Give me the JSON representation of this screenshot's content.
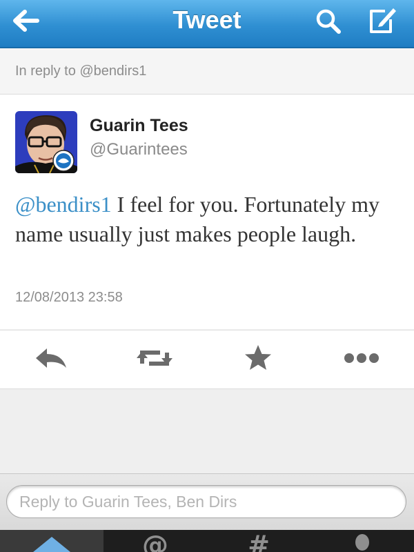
{
  "header": {
    "title": "Tweet",
    "back_icon": "back-arrow-icon",
    "search_icon": "search-icon",
    "compose_icon": "compose-icon"
  },
  "context": {
    "in_reply_to": "In reply to @bendirs1"
  },
  "tweet": {
    "author_name": "Guarin Tees",
    "author_handle": "@Guarintees",
    "mention": "@bendirs1",
    "text": " I feel for you. Fortunately my name usually just makes people laugh.",
    "timestamp": "12/08/2013 23:58"
  },
  "actions": [
    "reply-icon",
    "retweet-icon",
    "favorite-star-icon",
    "more-dots-icon"
  ],
  "reply_box": {
    "placeholder": "Reply to Guarin Tees, Ben Dirs"
  },
  "tabs": [
    {
      "name": "home",
      "icon": "home-icon",
      "glyph": ""
    },
    {
      "name": "connect",
      "icon": "at-icon",
      "glyph": "@"
    },
    {
      "name": "discover",
      "icon": "hashtag-icon",
      "glyph": "#"
    },
    {
      "name": "me",
      "icon": "person-icon",
      "glyph": ""
    }
  ],
  "colors": {
    "header_blue": "#2f8fd2",
    "mention_blue": "#3a8fc7",
    "avatar_bg": "#2d3dbd"
  }
}
